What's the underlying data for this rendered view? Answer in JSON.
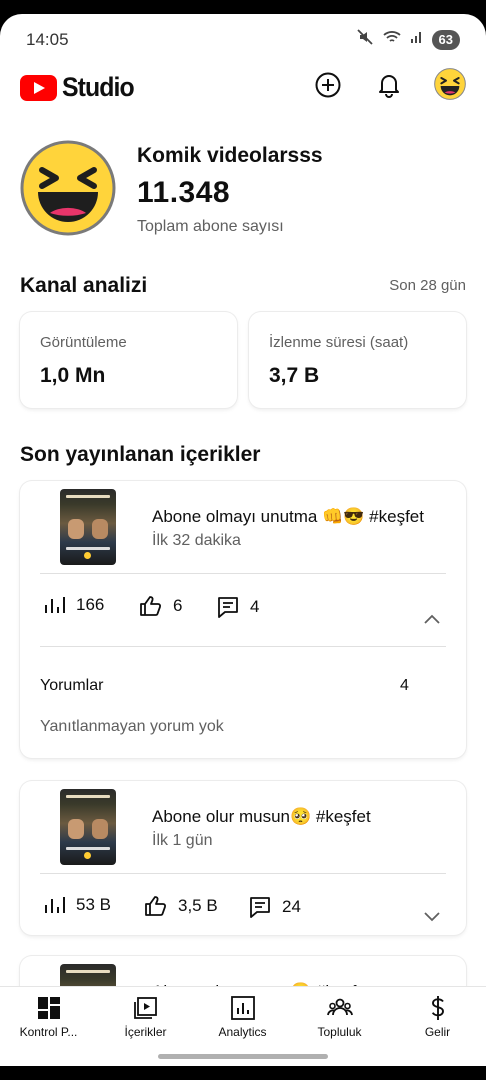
{
  "status": {
    "time": "14:05",
    "battery": "63"
  },
  "app": {
    "logo_text": "Studio"
  },
  "channel": {
    "name": "Komik videolarsss",
    "subscribers": "11.348",
    "subscribers_label": "Toplam abone sayısı"
  },
  "analytics": {
    "title": "Kanal analizi",
    "period": "Son 28 gün",
    "cards": [
      {
        "label": "Görüntüleme",
        "value": "1,0 Mn"
      },
      {
        "label": "İzlenme süresi (saat)",
        "value": "3,7 B"
      }
    ]
  },
  "recent": {
    "title": "Son yayınlanan içerikler",
    "items": [
      {
        "title": "Abone olmayı unutma 👊😎 #keşfet",
        "subtitle": "İlk 32 dakika",
        "views": "166",
        "likes": "6",
        "comments": "4",
        "expanded": true,
        "comments_label": "Yorumlar",
        "comments_count": "4",
        "comments_note": "Yanıtlanmayan yorum yok"
      },
      {
        "title": "Abone olur musun🥺 #keşfet",
        "subtitle": "İlk 1 gün",
        "views": "53 B",
        "likes": "3,5 B",
        "comments": "24",
        "expanded": false
      },
      {
        "title": "Abone olur musun🥺 #keşfet"
      }
    ]
  },
  "nav": {
    "items": [
      {
        "label": "Kontrol P...",
        "icon": "dashboard-icon"
      },
      {
        "label": "İçerikler",
        "icon": "content-icon"
      },
      {
        "label": "Analytics",
        "icon": "analytics-icon"
      },
      {
        "label": "Topluluk",
        "icon": "community-icon"
      },
      {
        "label": "Gelir",
        "icon": "dollar-icon"
      }
    ]
  },
  "colors": {
    "brand_red": "#ff0000",
    "text": "#0f0f0f",
    "secondary_text": "#606060",
    "emoji_yellow": "#ffd43b"
  }
}
